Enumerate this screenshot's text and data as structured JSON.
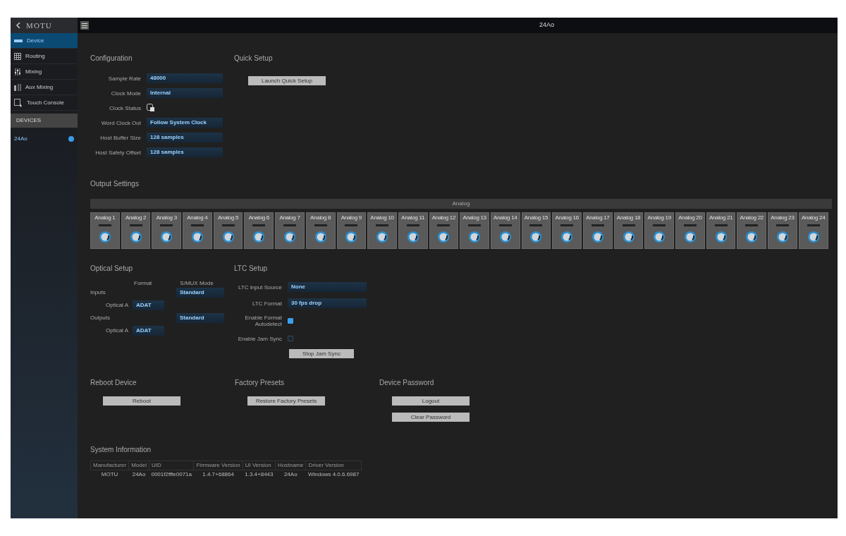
{
  "window": {
    "title": "24Ao"
  },
  "sidebar": {
    "logo": "MOTU",
    "items": [
      {
        "label": "Device",
        "selected": true,
        "kind": "device"
      },
      {
        "label": "Routing",
        "selected": false,
        "kind": "routing"
      },
      {
        "label": "Mixing",
        "selected": false,
        "kind": "mixing"
      },
      {
        "label": "Aux Mixing",
        "selected": false,
        "kind": "aux"
      },
      {
        "label": "Touch Console",
        "selected": false,
        "kind": "touch"
      }
    ],
    "devices_header": "DEVICES",
    "devices": [
      {
        "label": "24Ao",
        "selected": true
      }
    ]
  },
  "configuration": {
    "title": "Configuration",
    "fields": [
      {
        "label": "Sample Rate",
        "value": "48000",
        "kind": "select"
      },
      {
        "label": "Clock Mode",
        "value": "Internal",
        "kind": "select"
      },
      {
        "label": "Clock Status",
        "kind": "status"
      },
      {
        "label": "Word Clock Out",
        "value": "Follow System Clock",
        "kind": "select"
      },
      {
        "label": "Host Buffer Size",
        "value": "128 samples",
        "kind": "select"
      },
      {
        "label": "Host Safety Offset",
        "value": "128 samples",
        "kind": "select"
      }
    ]
  },
  "quick_setup": {
    "title": "Quick Setup",
    "button": "Launch Quick Setup"
  },
  "output_settings": {
    "title": "Output Settings",
    "group": "Analog",
    "channels": [
      {
        "name": "Analog 1"
      },
      {
        "name": "Analog 2"
      },
      {
        "name": "Analog 3"
      },
      {
        "name": "Analog 4"
      },
      {
        "name": "Analog 5"
      },
      {
        "name": "Analog 6"
      },
      {
        "name": "Analog 7"
      },
      {
        "name": "Analog 8"
      },
      {
        "name": "Analog 9"
      },
      {
        "name": "Analog 10"
      },
      {
        "name": "Analog 11"
      },
      {
        "name": "Analog 12"
      },
      {
        "name": "Analog 13"
      },
      {
        "name": "Analog 14"
      },
      {
        "name": "Analog 15"
      },
      {
        "name": "Analog 16"
      },
      {
        "name": "Analog 17"
      },
      {
        "name": "Analog 18"
      },
      {
        "name": "Analog 19"
      },
      {
        "name": "Analog 20"
      },
      {
        "name": "Analog 21"
      },
      {
        "name": "Analog 22"
      },
      {
        "name": "Analog 23"
      },
      {
        "name": "Analog 24"
      }
    ]
  },
  "optical_setup": {
    "title": "Optical Setup",
    "columns": [
      "Format",
      "S/MUX Mode"
    ],
    "groups": [
      {
        "label": "Inputs",
        "port": "Optical A",
        "format": "ADAT",
        "smux": "Standard"
      },
      {
        "label": "Outputs",
        "port": "Optical A",
        "format": "ADAT",
        "smux": "Standard"
      }
    ]
  },
  "ltc_setup": {
    "title": "LTC Setup",
    "fields": [
      {
        "label": "LTC Input Source",
        "value": "None",
        "kind": "select"
      },
      {
        "label": "LTC Format",
        "value": "30 fps drop",
        "kind": "select"
      },
      {
        "label": "Enable Format Autodetect",
        "checked": true,
        "kind": "checkbox"
      },
      {
        "label": "Enable Jam Sync",
        "checked": false,
        "kind": "checkbox"
      }
    ],
    "button": "Stop Jam Sync"
  },
  "reboot": {
    "title": "Reboot Device",
    "buttons": [
      "Reboot"
    ]
  },
  "factory": {
    "title": "Factory Presets",
    "buttons": [
      "Restore Factory Presets"
    ]
  },
  "password": {
    "title": "Device Password",
    "buttons": [
      "Logout",
      "Clear Password"
    ]
  },
  "system_information": {
    "title": "System Information",
    "columns": [
      "Manufacturer",
      "Model",
      "UID",
      "Firmware Version",
      "UI Version",
      "Hostname",
      "Driver Version"
    ],
    "row": [
      "MOTU",
      "24Ao",
      "0001f2fffe0071a",
      "1.4.7+68864",
      "1.3.4+8443",
      "24Ao",
      "Windows 4.0.6.6987"
    ]
  }
}
